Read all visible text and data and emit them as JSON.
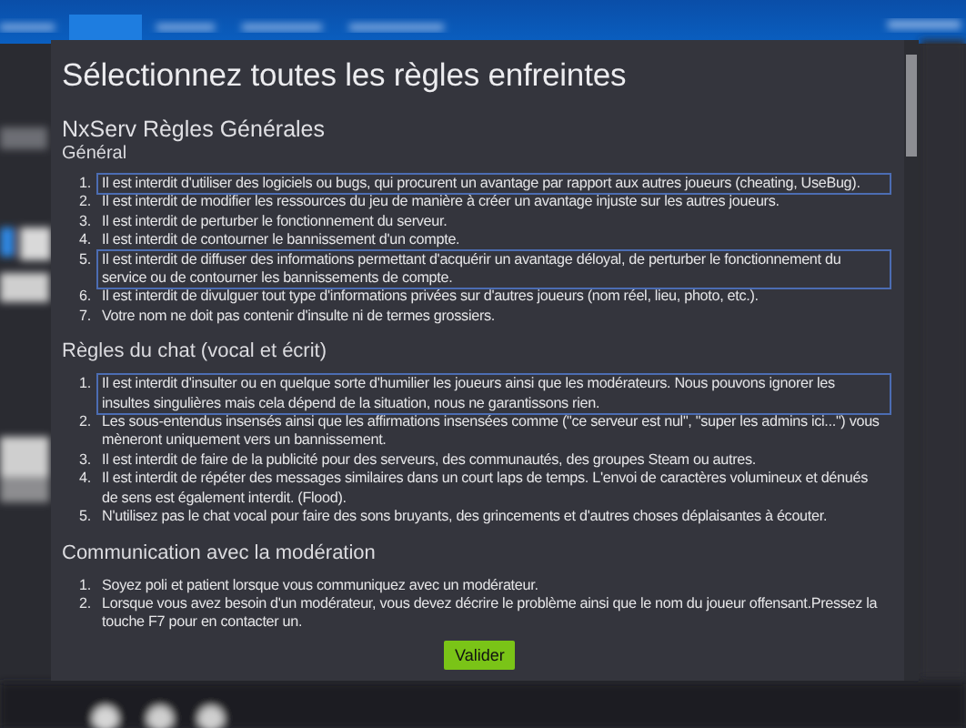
{
  "dialog": {
    "title": "Sélectionnez toutes les règles enfreintes",
    "rulebook": "NxServ Règles Générales",
    "sections": [
      {
        "title": "Général",
        "rules": [
          {
            "number": "1.",
            "text": "Il est interdit d'utiliser des logiciels ou bugs, qui procurent un avantage par rapport aux autres joueurs (cheating, UseBug).",
            "selected": true
          },
          {
            "number": "2.",
            "text": "Il est interdit de modifier les ressources du jeu de manière à créer un avantage injuste sur les autres joueurs.",
            "selected": false
          },
          {
            "number": "3.",
            "text": "Il est interdit de perturber le fonctionnement du serveur.",
            "selected": false
          },
          {
            "number": "4.",
            "text": "Il est interdit de contourner le bannissement d'un compte.",
            "selected": false
          },
          {
            "number": "5.",
            "text": "Il est interdit de diffuser des informations permettant d'acquérir un avantage déloyal, de perturber le fonctionnement du service ou de contourner les bannissements de compte.",
            "selected": true
          },
          {
            "number": "6.",
            "text": "Il est interdit de divulguer tout type d'informations privées sur d'autres joueurs (nom réel, lieu, photo, etc.).",
            "selected": false
          },
          {
            "number": "7.",
            "text": "Votre nom ne doit pas contenir d'insulte ni de termes grossiers.",
            "selected": false
          }
        ]
      },
      {
        "title": "Règles du chat (vocal et écrit)",
        "rules": [
          {
            "number": "1.",
            "text": "Il est interdit d'insulter ou en quelque sorte d'humilier les joueurs ainsi que les modérateurs. Nous pouvons ignorer les insultes singulières mais cela dépend de la situation, nous ne garantissons rien.",
            "selected": true
          },
          {
            "number": "2.",
            "text": "Les sous-entendus insensés ainsi que les affirmations insensées comme (\"ce serveur est nul\", \"super les admins ici...\") vous mèneront uniquement vers un bannissement.",
            "selected": false
          },
          {
            "number": "3.",
            "text": "Il est interdit de faire de la publicité pour des serveurs, des communautés, des groupes Steam ou autres.",
            "selected": false
          },
          {
            "number": "4.",
            "text": "Il est interdit de répéter des messages similaires dans un court laps de temps. L'envoi de caractères volumineux et dénués de sens est également interdit. (Flood).",
            "selected": false
          },
          {
            "number": "5.",
            "text": "N'utilisez pas le chat vocal pour faire des sons bruyants, des grincements et d'autres choses déplaisantes à écouter.",
            "selected": false
          }
        ]
      },
      {
        "title": "Communication avec la modération",
        "rules": [
          {
            "number": "1.",
            "text": "Soyez poli et patient lorsque vous communiquez avec un modérateur.",
            "selected": false
          },
          {
            "number": "2.",
            "text": "Lorsque vous avez besoin d'un modérateur, vous devez décrire le problème ainsi que le nom du joueur offensant.Pressez la touche F7 pour en contacter un.",
            "selected": false
          }
        ]
      }
    ],
    "button": "Valider"
  }
}
